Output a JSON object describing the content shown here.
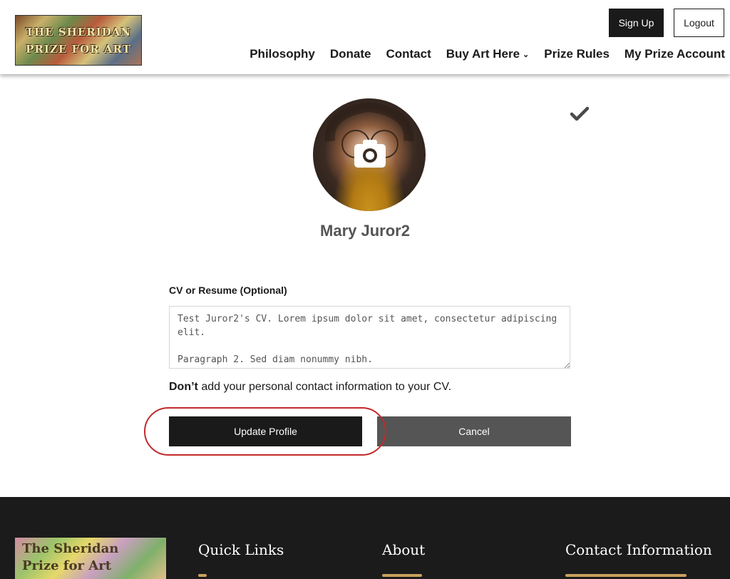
{
  "header": {
    "logo_text": "THE SHERIDAN PRIZE FOR ART",
    "sign_up_label": "Sign Up",
    "logout_label": "Logout",
    "nav": [
      {
        "label": "Philosophy"
      },
      {
        "label": "Donate"
      },
      {
        "label": "Contact"
      },
      {
        "label": "Buy Art Here",
        "has_dropdown": true,
        "chevron": "⌄"
      },
      {
        "label": "Prize Rules"
      },
      {
        "label": "My Prize Account"
      }
    ]
  },
  "profile": {
    "name": "Mary Juror2",
    "avatar_icon": "camera-icon",
    "status_icon": "checkmark-icon"
  },
  "form": {
    "cv_label": "CV or Resume (Optional)",
    "cv_value": "Test Juror2's CV. Lorem ipsum dolor sit amet, consectetur adipiscing elit.\n\nParagraph 2. Sed diam nonummy nibh.",
    "note_bold": "Don’t",
    "note_rest": " add your personal contact information to your CV.",
    "update_label": "Update Profile",
    "cancel_label": "Cancel"
  },
  "footer": {
    "logo_text": "The Sheridan Prize for Art",
    "headings": [
      "Quick Links",
      "About",
      "Contact Information"
    ]
  },
  "colors": {
    "dark": "#1a1a1a",
    "cancel_gray": "#555555",
    "footer_bg": "#1b1b1b",
    "highlight_red": "#c32a2a",
    "footer_link": "#c9a15c"
  }
}
